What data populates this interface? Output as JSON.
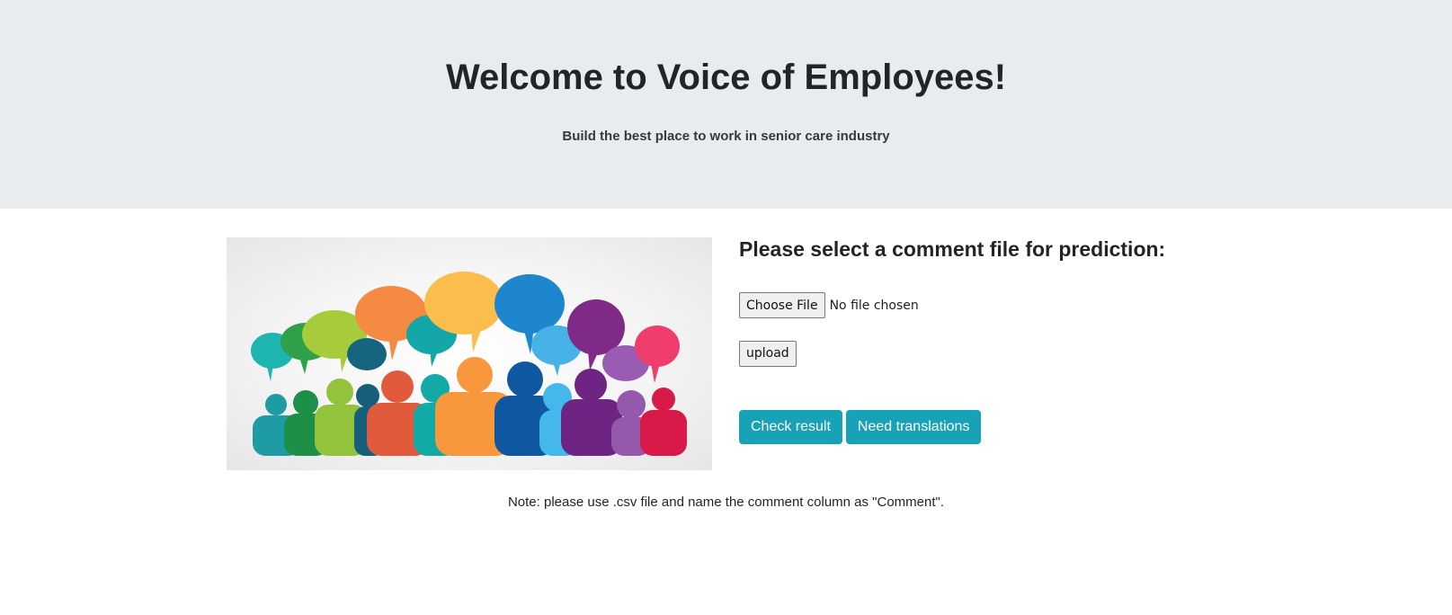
{
  "header": {
    "title": "Welcome to Voice of Employees!",
    "subtitle": "Build the best place to work in senior care industry"
  },
  "form": {
    "heading": "Please select a comment file for prediction:",
    "choose_file_label": "Choose File",
    "file_status": "No file chosen",
    "upload_label": "upload",
    "check_result_label": "Check result",
    "need_translations_label": "Need translations"
  },
  "note": "Note: please use .csv file and name the comment column as \"Comment\".",
  "colors": {
    "jumbotron_bg": "#e9ecef",
    "button_info": "#17a2b8"
  },
  "illustration": {
    "icon": "people-speech-bubbles-illustration"
  }
}
